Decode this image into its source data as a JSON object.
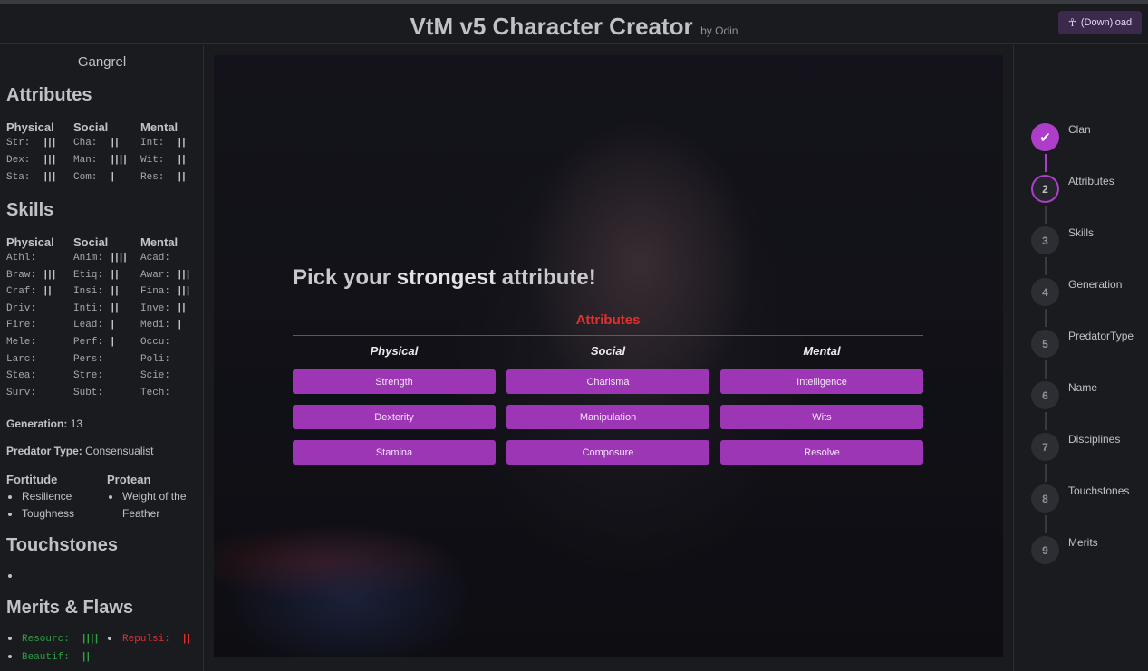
{
  "header": {
    "title": "VtM v5 Character Creator",
    "by": "by Odin",
    "download_label": "(Down)load",
    "download_icon": "ankh-icon"
  },
  "sidebar": {
    "clan": "Gangrel",
    "attributes_title": "Attributes",
    "attr_cols": [
      "Physical",
      "Social",
      "Mental"
    ],
    "attributes": [
      [
        {
          "k": "Str:",
          "d": "|||"
        },
        {
          "k": "Dex:",
          "d": "|||"
        },
        {
          "k": "Sta:",
          "d": "|||"
        }
      ],
      [
        {
          "k": "Cha:",
          "d": "||"
        },
        {
          "k": "Man:",
          "d": "||||"
        },
        {
          "k": "Com:",
          "d": "|"
        }
      ],
      [
        {
          "k": "Int:",
          "d": "||"
        },
        {
          "k": "Wit:",
          "d": "||"
        },
        {
          "k": "Res:",
          "d": "||"
        }
      ]
    ],
    "skills_title": "Skills",
    "skill_cols": [
      "Physical",
      "Social",
      "Mental"
    ],
    "skills": [
      [
        {
          "k": "Athl:",
          "d": ""
        },
        {
          "k": "Braw:",
          "d": "|||"
        },
        {
          "k": "Craf:",
          "d": "||"
        },
        {
          "k": "Driv:",
          "d": ""
        },
        {
          "k": "Fire:",
          "d": ""
        },
        {
          "k": "Mele:",
          "d": ""
        },
        {
          "k": "Larc:",
          "d": ""
        },
        {
          "k": "Stea:",
          "d": ""
        },
        {
          "k": "Surv:",
          "d": ""
        }
      ],
      [
        {
          "k": "Anim:",
          "d": "||||"
        },
        {
          "k": "Etiq:",
          "d": "||"
        },
        {
          "k": "Insi:",
          "d": "||"
        },
        {
          "k": "Inti:",
          "d": "||"
        },
        {
          "k": "Lead:",
          "d": "|"
        },
        {
          "k": "Perf:",
          "d": "|"
        },
        {
          "k": "Pers:",
          "d": ""
        },
        {
          "k": "Stre:",
          "d": ""
        },
        {
          "k": "Subt:",
          "d": ""
        }
      ],
      [
        {
          "k": "Acad:",
          "d": ""
        },
        {
          "k": "Awar:",
          "d": "|||"
        },
        {
          "k": "Fina:",
          "d": "|||"
        },
        {
          "k": "Inve:",
          "d": "||"
        },
        {
          "k": "Medi:",
          "d": "|"
        },
        {
          "k": "Occu:",
          "d": ""
        },
        {
          "k": "Poli:",
          "d": ""
        },
        {
          "k": "Scie:",
          "d": ""
        },
        {
          "k": "Tech:",
          "d": ""
        }
      ]
    ],
    "generation_label": "Generation:",
    "generation_value": "13",
    "predator_label": "Predator Type:",
    "predator_value": "Consensualist",
    "disciplines": [
      {
        "name": "Fortitude",
        "powers": [
          "Resilience",
          "Toughness"
        ]
      },
      {
        "name": "Protean",
        "powers": [
          "Weight of the",
          "Feather"
        ]
      }
    ],
    "touchstones_title": "Touchstones",
    "merits_title": "Merits & Flaws",
    "merits": [
      {
        "name": "Resourc:",
        "dots": "||||",
        "color": "#2f9e44"
      },
      {
        "name": "Repulsi:",
        "dots": "||",
        "color": "#e03131"
      },
      {
        "name": "Beautif:",
        "dots": "||",
        "color": "#2f9e44"
      }
    ]
  },
  "main": {
    "prompt_pre": "Pick your ",
    "prompt_strong": "strongest",
    "prompt_post": " attribute!",
    "section_title": "Attributes",
    "categories": [
      "Physical",
      "Social",
      "Mental"
    ],
    "buttons": [
      [
        "Strength",
        "Dexterity",
        "Stamina"
      ],
      [
        "Charisma",
        "Manipulation",
        "Composure"
      ],
      [
        "Intelligence",
        "Wits",
        "Resolve"
      ]
    ],
    "accent": "#9c36b5",
    "heading_color": "#e03131"
  },
  "stepper": {
    "steps": [
      {
        "num": "",
        "label": "Clan",
        "state": "done"
      },
      {
        "num": "2",
        "label": "Attributes",
        "state": "active"
      },
      {
        "num": "3",
        "label": "Skills",
        "state": "todo"
      },
      {
        "num": "4",
        "label": "Generation",
        "state": "todo"
      },
      {
        "num": "5",
        "label": "PredatorType",
        "state": "todo"
      },
      {
        "num": "6",
        "label": "Name",
        "state": "todo"
      },
      {
        "num": "7",
        "label": "Disciplines",
        "state": "todo"
      },
      {
        "num": "8",
        "label": "Touchstones",
        "state": "todo"
      },
      {
        "num": "9",
        "label": "Merits",
        "state": "todo"
      }
    ],
    "check_icon": "check-icon"
  }
}
